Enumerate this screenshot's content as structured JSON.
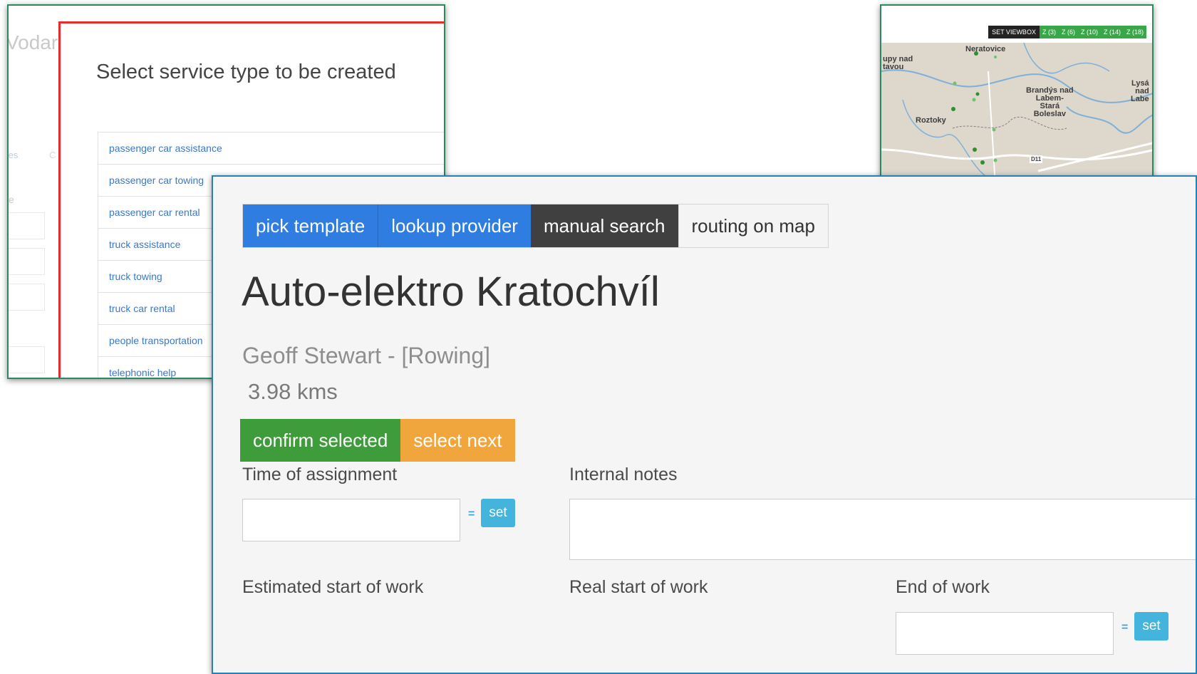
{
  "left_window": {
    "background_title": "Vodar",
    "background_link_1": "tes",
    "background_link_2": "C",
    "background_small": "e",
    "modal": {
      "title": "Select service type to be created",
      "items": [
        "passenger car assistance",
        "passenger car towing",
        "passenger car rental",
        "truck assistance",
        "truck towing",
        "truck car rental",
        "people transportation",
        "telephonic help"
      ]
    }
  },
  "map_window": {
    "set_viewbox": "SET VIEWBOX",
    "zoom_buttons": [
      "Z (3)",
      "Z (6)",
      "Z (10)",
      "Z (14)",
      "Z (18)"
    ],
    "labels": {
      "neratovice": "Neratovice",
      "kralupy": "upy nad\ntavou",
      "roztoky": "Roztoky",
      "brandys": "Brandýs nad\nLabem-\nStará\nBoleslav",
      "lysa": "Lysá\nnad\nLabe",
      "road": "D11"
    }
  },
  "main_window": {
    "tabs": {
      "pick_template": "pick template",
      "lookup_provider": "lookup provider",
      "manual_search": "manual search",
      "routing_on_map": "routing on map"
    },
    "provider_name": "Auto-elektro Kratochvíl",
    "provider_person": "Geoff Stewart - [Rowing]",
    "provider_distance": "3.98 kms",
    "buttons": {
      "confirm_selected": "confirm selected",
      "select_next": "select next"
    },
    "fields": {
      "time_of_assignment": "Time of assignment",
      "internal_notes": "Internal notes",
      "estimated_start": "Estimated start of work",
      "real_start": "Real start of work",
      "end_of_work": "End of work",
      "set_label": "set",
      "eq_symbol": "="
    }
  },
  "colors": {
    "tab_blue": "#2f7de1",
    "tab_dark": "#404040",
    "btn_green": "#3e9c3a",
    "btn_orange": "#f0a63c",
    "set_btn": "#44b4dc",
    "modal_border": "#e82a2a",
    "window_border": "#2a8a5e",
    "main_border": "#2a7fb7"
  }
}
